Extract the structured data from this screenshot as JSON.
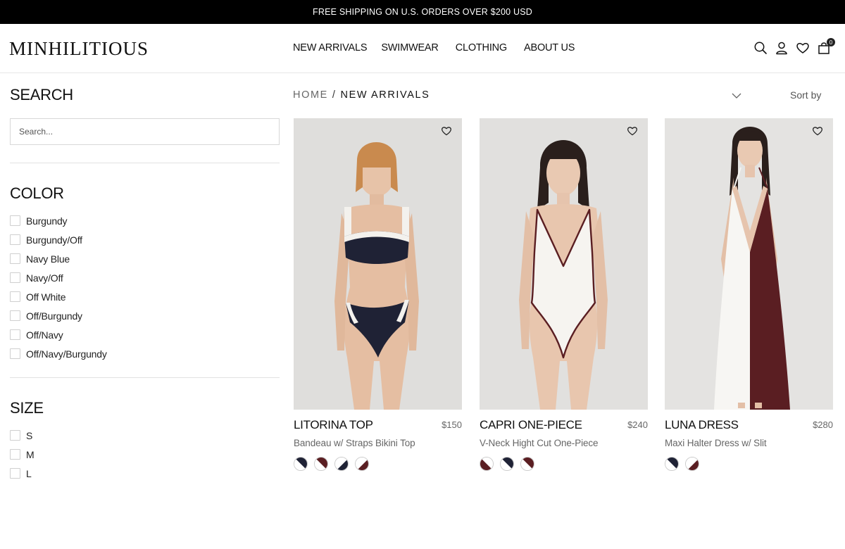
{
  "topbar": {
    "text": "FREE SHIPPING ON U.S. ORDERS OVER $200 USD"
  },
  "header": {
    "logo": "MINHILITIOUS",
    "nav": [
      "NEW ARRIVALS",
      "SWIMWEAR",
      "CLOTHING",
      "ABOUT US"
    ],
    "icons": [
      "search-icon",
      "account-icon",
      "wishlist-icon",
      "cart-icon"
    ],
    "cart_count": "0"
  },
  "sidebar": {
    "search_title": "SEARCH",
    "search_placeholder": "Search...",
    "color_title": "COLOR",
    "colors": [
      "Burgundy",
      "Burgundy/Off",
      "Navy Blue",
      "Navy/Off",
      "Off White",
      "Off/Burgundy",
      "Off/Navy",
      "Off/Navy/Burgundy"
    ],
    "size_title": "SIZE",
    "sizes": [
      "S",
      "M",
      "L"
    ]
  },
  "breadcrumb": {
    "home": "HOME",
    "separator": "/",
    "current": "NEW ARRIVALS"
  },
  "sort": {
    "label": "Sort by"
  },
  "colors": {
    "navy": "#1f2235",
    "burgundy": "#5a1e22",
    "off_white": "#f5f3ef"
  },
  "products": [
    {
      "name": "LITORINA TOP",
      "price": "$150",
      "description": "Bandeau w/ Straps Bikini Top",
      "swatches": [
        [
          "#ffffff",
          "#1f2235"
        ],
        [
          "#ffffff",
          "#5a1e22"
        ],
        [
          "#ffffff",
          "#1f2235"
        ],
        [
          "#ffffff",
          "#5a1e22"
        ]
      ]
    },
    {
      "name": "CAPRI ONE-PIECE",
      "price": "$240",
      "description": "V-Neck Hight Cut One-Piece",
      "swatches": [
        [
          "#ffffff",
          "#5a1e22"
        ],
        [
          "#ffffff",
          "#1f2235"
        ],
        [
          "#ffffff",
          "#5a1e22"
        ]
      ]
    },
    {
      "name": "LUNA DRESS",
      "price": "$280",
      "description": "Maxi Halter Dress w/ Slit",
      "swatches": [
        [
          "#ffffff",
          "#1f2235"
        ],
        [
          "#ffffff",
          "#5a1e22"
        ]
      ]
    }
  ]
}
